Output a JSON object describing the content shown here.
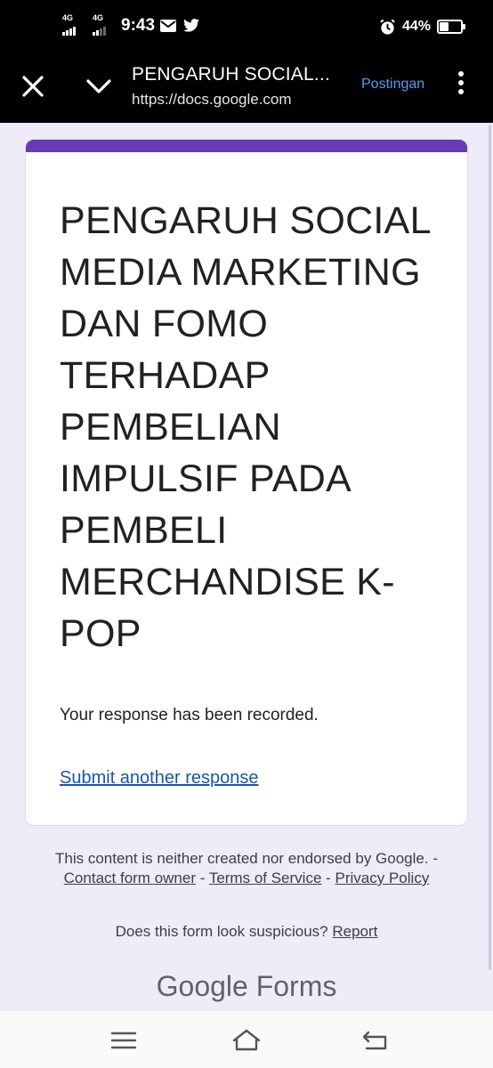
{
  "status_bar": {
    "net1": "4G",
    "net2": "4G",
    "time": "9:43",
    "battery_text": "44%",
    "battery_level": 0.44,
    "icons": [
      "mail-icon",
      "twitter-icon",
      "alarm-icon",
      "battery-icon"
    ]
  },
  "toolbar": {
    "title": "PENGARUH SOCIAL...",
    "url": "https://docs.google.com",
    "action_label": "Postingan",
    "icons": [
      "close-icon",
      "chevron-down-icon",
      "more-vert-icon"
    ]
  },
  "form": {
    "accent_color": "#673ab7",
    "title": "PENGARUH SOCIAL MEDIA MARKETING DAN FOMO TERHADAP PEMBELIAN IMPULSIF PADA PEMBELI MERCHANDISE K-POP",
    "confirmation": "Your response has been recorded.",
    "submit_another": "Submit another response"
  },
  "footer": {
    "disclaimer": "This content is neither created nor endorsed by Google.",
    "sep1": " - ",
    "contact_owner": "Contact form owner",
    "sep2": " - ",
    "terms": "Terms of Service",
    "sep3": " - ",
    "privacy": "Privacy Policy",
    "suspicious_question": "Does this form look suspicious?",
    "report": "Report",
    "brand_google": "Google",
    "brand_forms": "Forms"
  },
  "navbar": {
    "icons": [
      "menu-icon",
      "home-icon",
      "back-icon"
    ]
  }
}
